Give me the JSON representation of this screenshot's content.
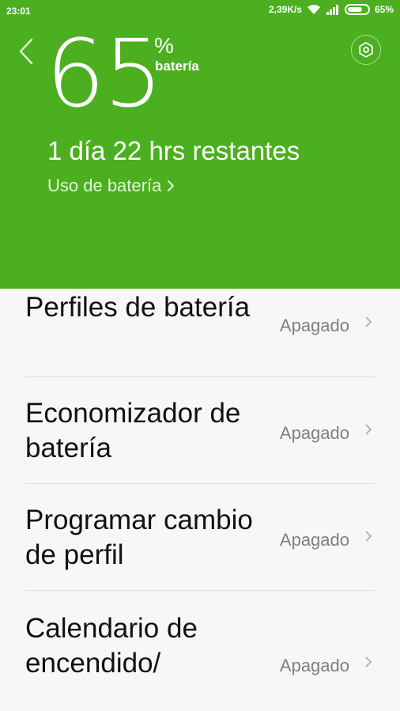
{
  "status_bar": {
    "time": "23:01",
    "network_speed": "2,39K/s",
    "battery_percent": "65%",
    "icons": [
      "wifi-icon",
      "signal-icon",
      "battery-icon"
    ]
  },
  "header": {
    "percent_value": "65",
    "percent_symbol": "%",
    "percent_label": "batería",
    "remaining": "1 día 22 hrs  restantes",
    "usage_link": "Uso de batería",
    "background_color": "#4caf1f",
    "icons": [
      "back-arrow-icon",
      "settings-gear-icon",
      "chevron-right-icon"
    ]
  },
  "settings": [
    {
      "title": "Perfiles de batería",
      "value": "Apagado"
    },
    {
      "title": "Economizador de batería",
      "value": "Apagado"
    },
    {
      "title": "Programar cambio de perfil",
      "value": "Apagado"
    },
    {
      "title": "Calendario de encendido/",
      "value": "Apagado"
    }
  ]
}
